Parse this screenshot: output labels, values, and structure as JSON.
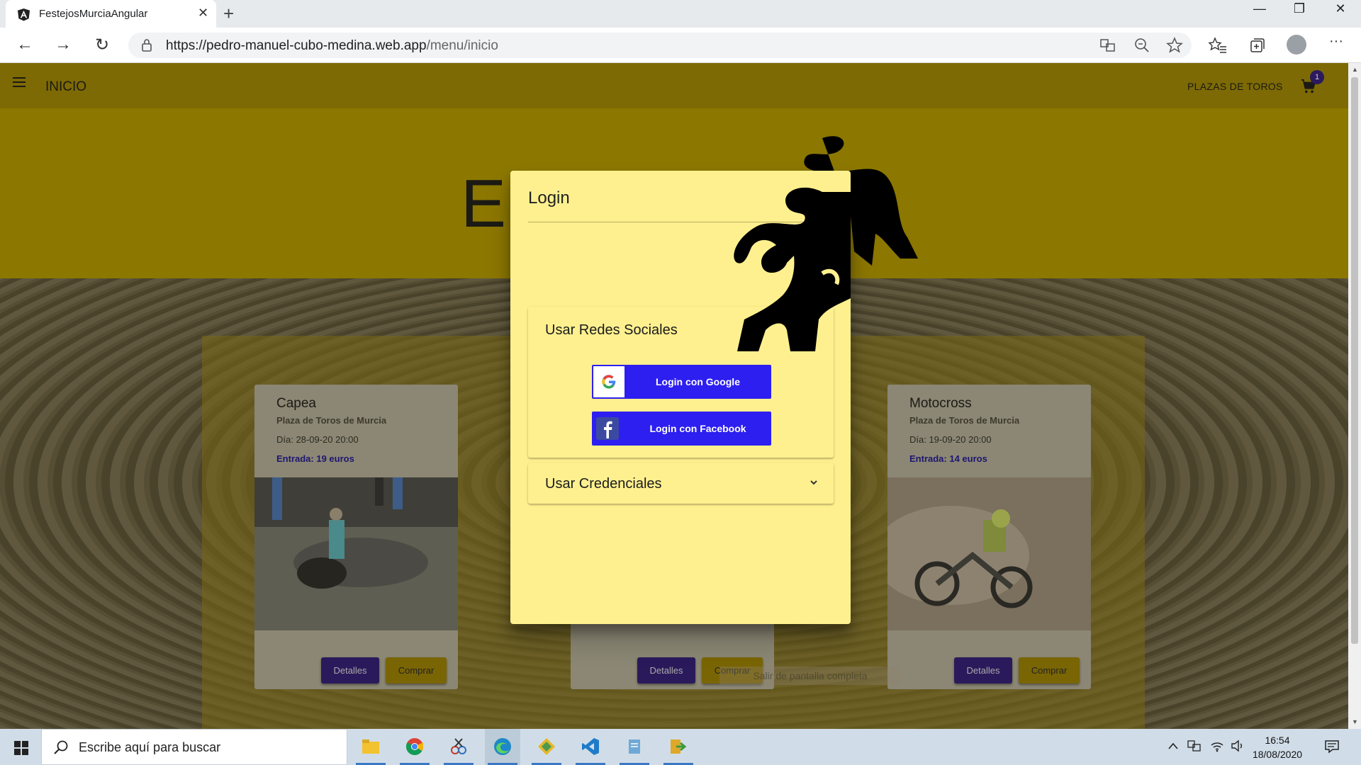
{
  "browser": {
    "tab_title": "FestejosMurciaAngular",
    "url_host": "https://pedro-manuel-cubo-medina.web.app",
    "url_path": "/menu/inicio",
    "new_tab_glyph": "+",
    "close_glyph": "✕",
    "minimize_glyph": "—",
    "maximize_glyph": "❐",
    "win_close_glyph": "✕",
    "back_glyph": "←",
    "forward_glyph": "→",
    "reload_glyph": "↻",
    "more_glyph": "···"
  },
  "app": {
    "title": "INICIO",
    "nav_link": "PLAZAS DE TOROS",
    "cart_count": "1",
    "hero_text": "El"
  },
  "cards": [
    {
      "title": "Capea",
      "venue": "Plaza de Toros de Murcia",
      "date": "Día: 28-09-20 20:00",
      "price": "Entrada: 19 euros",
      "details_label": "Detalles",
      "buy_label": "Comprar"
    },
    {
      "title": "",
      "venue": "",
      "date": "",
      "price": "",
      "details_label": "Detalles",
      "buy_label": "Comprar"
    },
    {
      "title": "Motocross",
      "venue": "Plaza de Toros de Murcia",
      "date": "Día: 19-09-20 20:00",
      "price": "Entrada: 14 euros",
      "details_label": "Detalles",
      "buy_label": "Comprar"
    }
  ],
  "fullscreen_hint": "Salir de pantalla completa",
  "dialog": {
    "title": "Login",
    "social_panel_title": "Usar Redes Sociales",
    "google_label": "Login con Google",
    "facebook_label": "Login con Facebook",
    "credentials_panel_title": "Usar Credenciales"
  },
  "taskbar": {
    "search_placeholder": "Escribe aquí para buscar",
    "time": "16:54",
    "date": "18/08/2020"
  },
  "colors": {
    "dialog_bg": "#fff08f",
    "social_button": "#2d1ff0",
    "details_button": "#2b1a5b",
    "buy_button": "#7a6504"
  }
}
